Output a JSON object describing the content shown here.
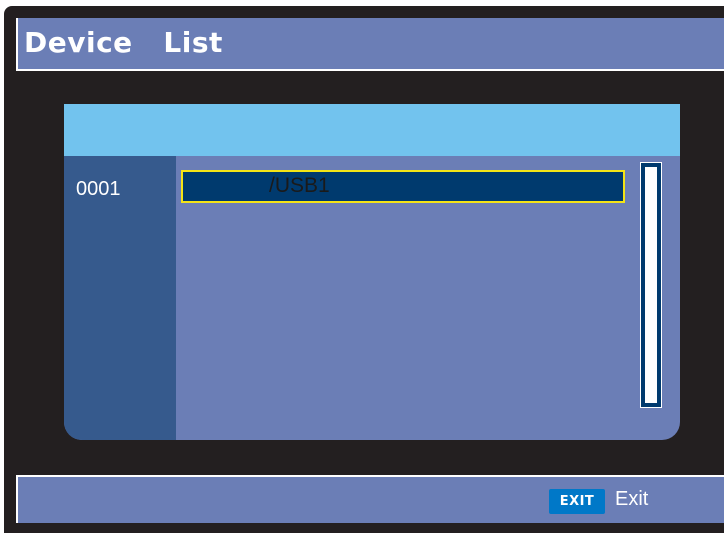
{
  "header": {
    "title": "Device   List"
  },
  "device_list": {
    "items": [
      {
        "index": "0001",
        "path": "/USB1",
        "selected": true
      }
    ]
  },
  "footer": {
    "exit_key": "EXIT",
    "exit_label": "Exit"
  },
  "colors": {
    "background": "#231f20",
    "bar": "#6b7eb6",
    "panel_header": "#72c3ee",
    "index_column": "#365a8d",
    "selected_row": "#003a6e",
    "selection_border": "#f4e416",
    "exit_key": "#0078c8"
  },
  "icons": {
    "scrollbar": "vertical-scrollbar"
  }
}
